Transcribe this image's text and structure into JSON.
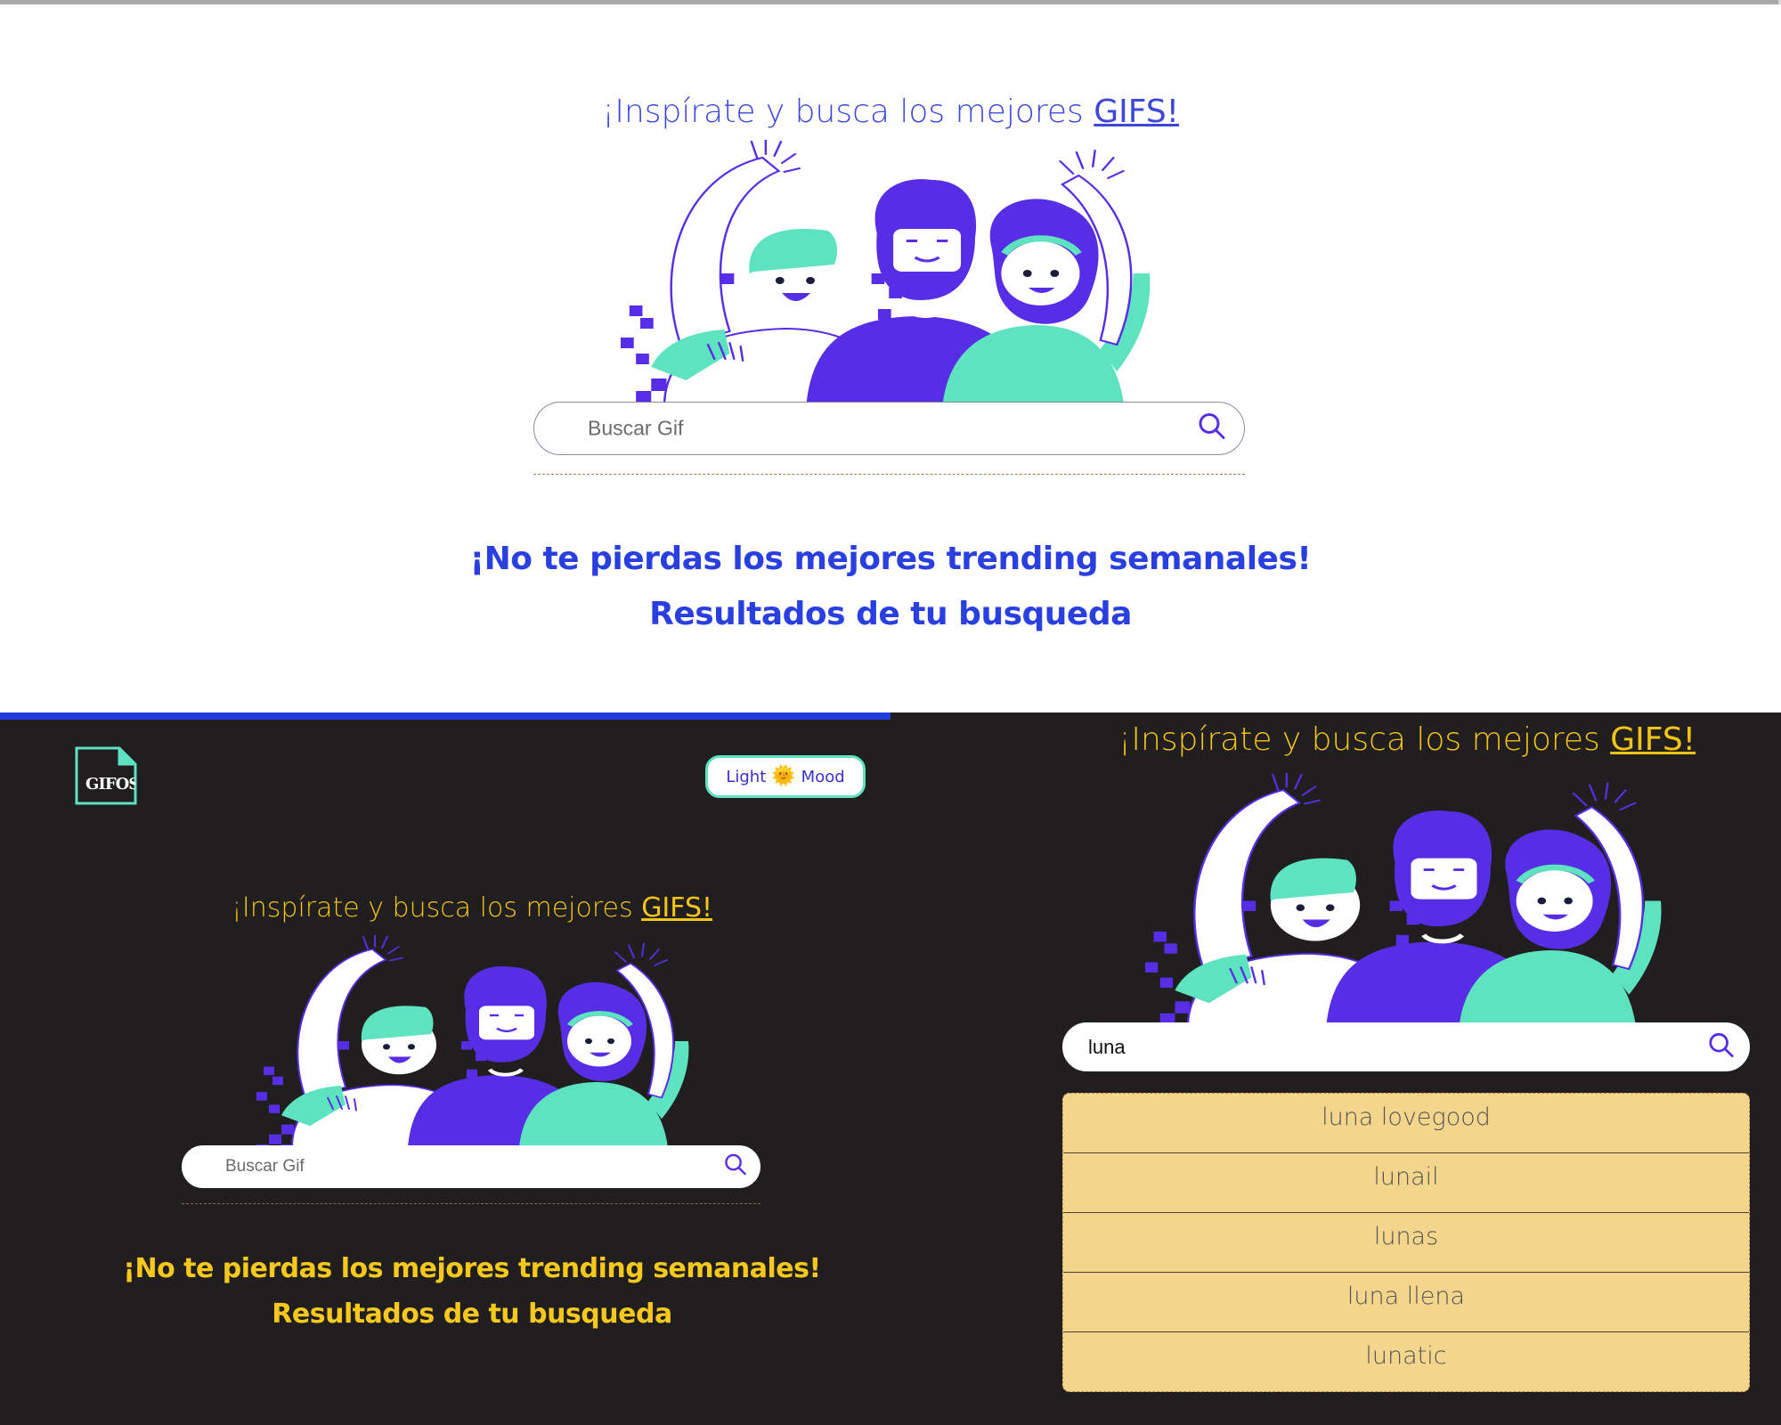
{
  "light": {
    "tagline_prefix": "¡Inspírate y busca los mejores ",
    "tagline_link": "GIFS!",
    "search_placeholder": "Buscar Gif",
    "trending_heading": "¡No te pierdas los mejores trending semanales!",
    "results_heading": "Resultados de tu busqueda"
  },
  "dark_left": {
    "logo_text": "GIFOS",
    "mood_label_left": "Light",
    "mood_label_right": "Mood",
    "tagline_prefix": "¡Inspírate y busca los mejores ",
    "tagline_link": "GIFS!",
    "search_placeholder": "Buscar Gif",
    "trending_heading": "¡No te pierdas los mejores trending semanales!",
    "results_heading": "Resultados de tu busqueda"
  },
  "dark_right": {
    "tagline_prefix": "¡Inspírate y busca los mejores ",
    "tagline_link": "GIFS!",
    "search_value": "luna",
    "suggestions": [
      "luna lovegood",
      "lunail",
      "lunas",
      "luna llena",
      "lunatic"
    ]
  },
  "icons": {
    "search": "search-icon",
    "sun": "sun-icon",
    "logo": "gifos-logo"
  },
  "colors": {
    "light_accent": "#3d47d9",
    "dark_accent": "#f5c515",
    "teal": "#5ee3c0",
    "purple": "#572ee5",
    "dark_bg": "#201e1f",
    "suggestion_bg": "#f4d58c"
  }
}
